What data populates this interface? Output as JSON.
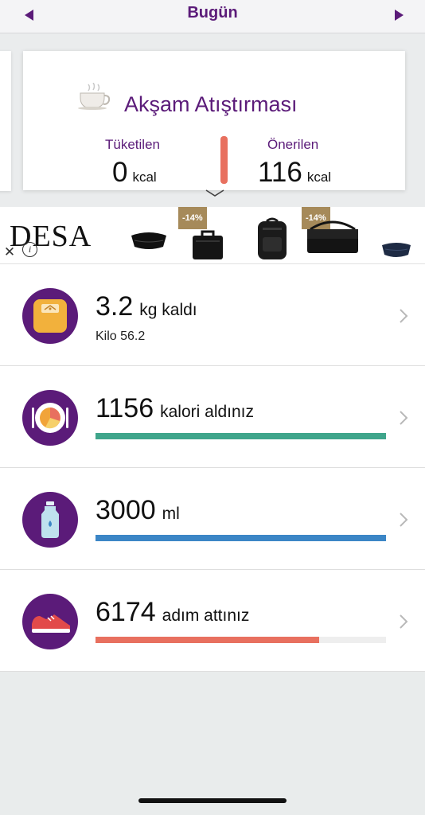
{
  "header": {
    "title": "Bugün",
    "prev_icon": "triangle-left-icon",
    "next_icon": "triangle-right-icon"
  },
  "meal_card": {
    "title": "Akşam Atıştırması",
    "icon": "teacup-icon",
    "consumed_label": "Tüketilen",
    "consumed_value": "0",
    "consumed_unit": "kcal",
    "recommended_label": "Önerilen",
    "recommended_value": "116",
    "recommended_unit": "kcal"
  },
  "ad": {
    "brand": "DESA",
    "badges": [
      "-14%",
      "-14%"
    ],
    "close_glyph": "✕",
    "info_glyph": "i"
  },
  "trackers": [
    {
      "id": "weight",
      "icon": "scale-icon",
      "value": "3.2",
      "unit": "kg kaldı",
      "subtitle": "Kilo 56.2"
    },
    {
      "id": "calories",
      "icon": "plate-icon",
      "value": "1156",
      "unit": "kalori aldınız",
      "progress": 1.0,
      "color": "#3fa58b"
    },
    {
      "id": "water",
      "icon": "water-bottle-icon",
      "value": "3000",
      "unit": "ml",
      "progress": 1.0,
      "color": "#3b86c6"
    },
    {
      "id": "steps",
      "icon": "sneaker-icon",
      "value": "6174",
      "unit": "adım attınız",
      "progress": 0.77,
      "color": "#e8705f"
    }
  ],
  "colors": {
    "brand_purple": "#5b1b79",
    "meal_bar": "#e8705f"
  }
}
